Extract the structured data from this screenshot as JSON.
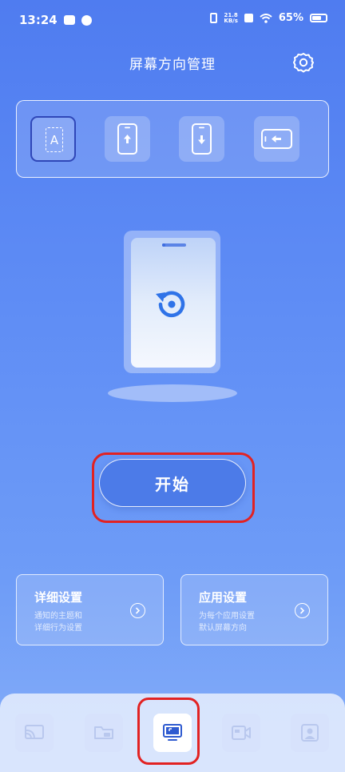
{
  "status_bar": {
    "time": "13:24",
    "net_speed_value": "21.8",
    "net_speed_unit": "KB/s",
    "battery_percent": "65%"
  },
  "header": {
    "title": "屏幕方向管理"
  },
  "mode_selector": {
    "auto_label": "A",
    "selected": "auto",
    "options": [
      "auto",
      "portrait",
      "portrait-reverse",
      "landscape"
    ]
  },
  "start_button": {
    "label": "开始"
  },
  "cards": [
    {
      "title": "详细设置",
      "desc": "通知的主题和\n详细行为设置"
    },
    {
      "title": "应用设置",
      "desc": "为每个应用设置\n默认屏幕方向"
    }
  ],
  "bottom_nav": {
    "active_index": 2,
    "items": [
      "cast-icon",
      "folder-icon",
      "screen-icon",
      "video-icon",
      "portrait-icon"
    ]
  },
  "colors": {
    "accent": "#4c7be8",
    "selected_border": "#2f47b8",
    "highlight": "#e22222"
  }
}
